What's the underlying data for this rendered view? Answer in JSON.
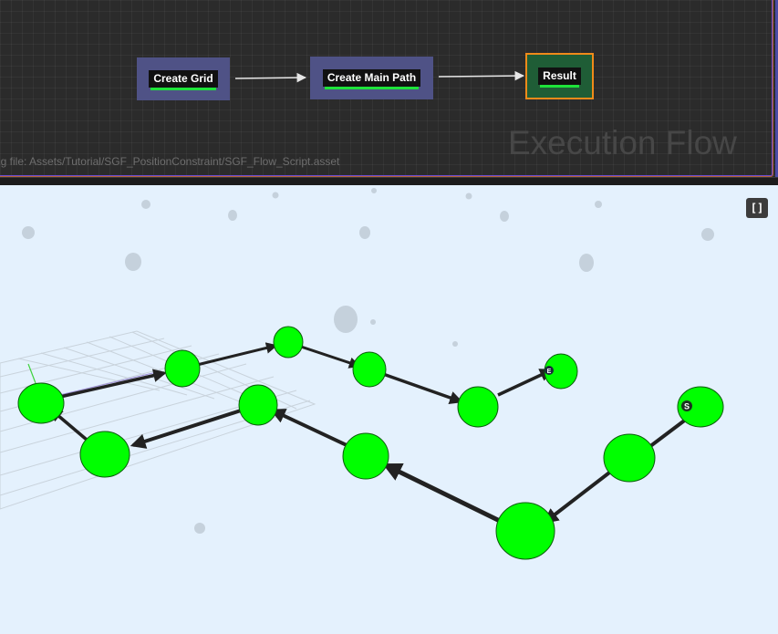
{
  "flow_graph": {
    "nodes": [
      {
        "id": "create_grid",
        "label": "Create Grid"
      },
      {
        "id": "create_main_path",
        "label": "Create Main Path"
      },
      {
        "id": "result",
        "label": "Result"
      }
    ],
    "watermark": "Execution Flow",
    "file_label": "ng file: Assets/Tutorial/SGF_PositionConstraint/SGF_Flow_Script.asset",
    "colors": {
      "background": "#2b2b2b",
      "node": "#4f5286",
      "result_node": "#1f5d36",
      "selection_border": "#f08a1a",
      "node_underline": "#1ee33a"
    }
  },
  "scene": {
    "toggle_icon": "brackets-toggle-icon",
    "toggle_label": "[]",
    "start_marker": "S",
    "end_marker": "E",
    "colors": {
      "background": "#e4f1fd",
      "path_node": "#00ff00",
      "arrow": "#222222",
      "grid": "#c7d1da",
      "dots": "#c8d3de"
    }
  }
}
